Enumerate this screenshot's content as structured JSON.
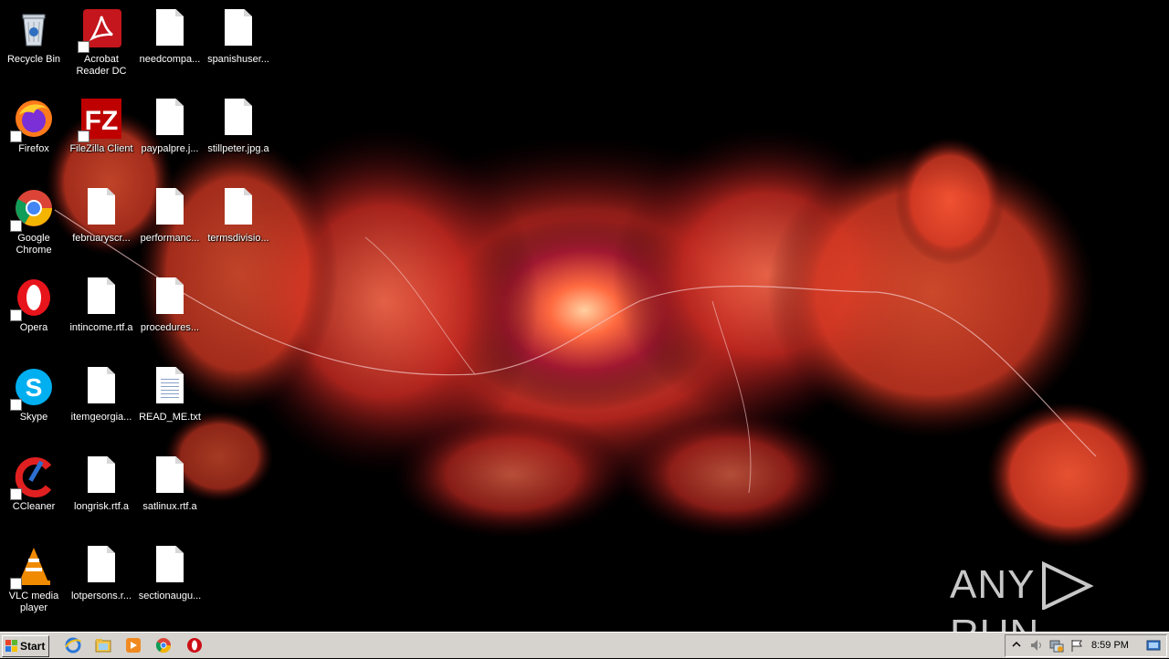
{
  "desktop_icons": [
    {
      "label": "Recycle Bin",
      "icon": "recycle-bin-icon"
    },
    {
      "label": "Acrobat Reader DC",
      "icon": "acrobat-icon"
    },
    {
      "label": "needcompa...",
      "icon": "file-icon"
    },
    {
      "label": "spanishuser...",
      "icon": "file-icon"
    },
    {
      "label": "Firefox",
      "icon": "firefox-icon"
    },
    {
      "label": "FileZilla Client",
      "icon": "filezilla-icon"
    },
    {
      "label": "paypalpre.j...",
      "icon": "file-icon"
    },
    {
      "label": "stillpeter.jpg.a",
      "icon": "file-icon"
    },
    {
      "label": "Google Chrome",
      "icon": "chrome-icon"
    },
    {
      "label": "februaryscr...",
      "icon": "file-icon"
    },
    {
      "label": "performanc...",
      "icon": "file-icon"
    },
    {
      "label": "termsdivisio...",
      "icon": "file-icon"
    },
    {
      "label": "Opera",
      "icon": "opera-icon"
    },
    {
      "label": "intincome.rtf.a",
      "icon": "file-icon"
    },
    {
      "label": "procedures...",
      "icon": "file-icon"
    },
    {
      "label": "Skype",
      "icon": "skype-icon"
    },
    {
      "label": "itemgeorgia...",
      "icon": "file-icon"
    },
    {
      "label": "READ_ME.txt",
      "icon": "text-file-icon"
    },
    {
      "label": "CCleaner",
      "icon": "ccleaner-icon"
    },
    {
      "label": "longrisk.rtf.a",
      "icon": "file-icon"
    },
    {
      "label": "satlinux.rtf.a",
      "icon": "file-icon"
    },
    {
      "label": "VLC media player",
      "icon": "vlc-icon"
    },
    {
      "label": "lotpersons.r...",
      "icon": "file-icon"
    },
    {
      "label": "sectionaugu...",
      "icon": "file-icon"
    }
  ],
  "watermark": {
    "left": "ANY",
    "right": "RUN"
  },
  "taskbar": {
    "start_label": "Start",
    "quick_launch": [
      "internet-explorer-icon",
      "file-explorer-icon",
      "media-player-icon",
      "chrome-icon",
      "opera-icon"
    ],
    "tray_icons": [
      "show-hidden-icons-icon",
      "volume-icon",
      "network-icon",
      "action-center-flag-icon"
    ],
    "clock": "8:59 PM"
  },
  "colors": {
    "taskbar": "#d6d3ce",
    "desktop": "#000000",
    "wallpaper_accent": "#ff5a36"
  }
}
